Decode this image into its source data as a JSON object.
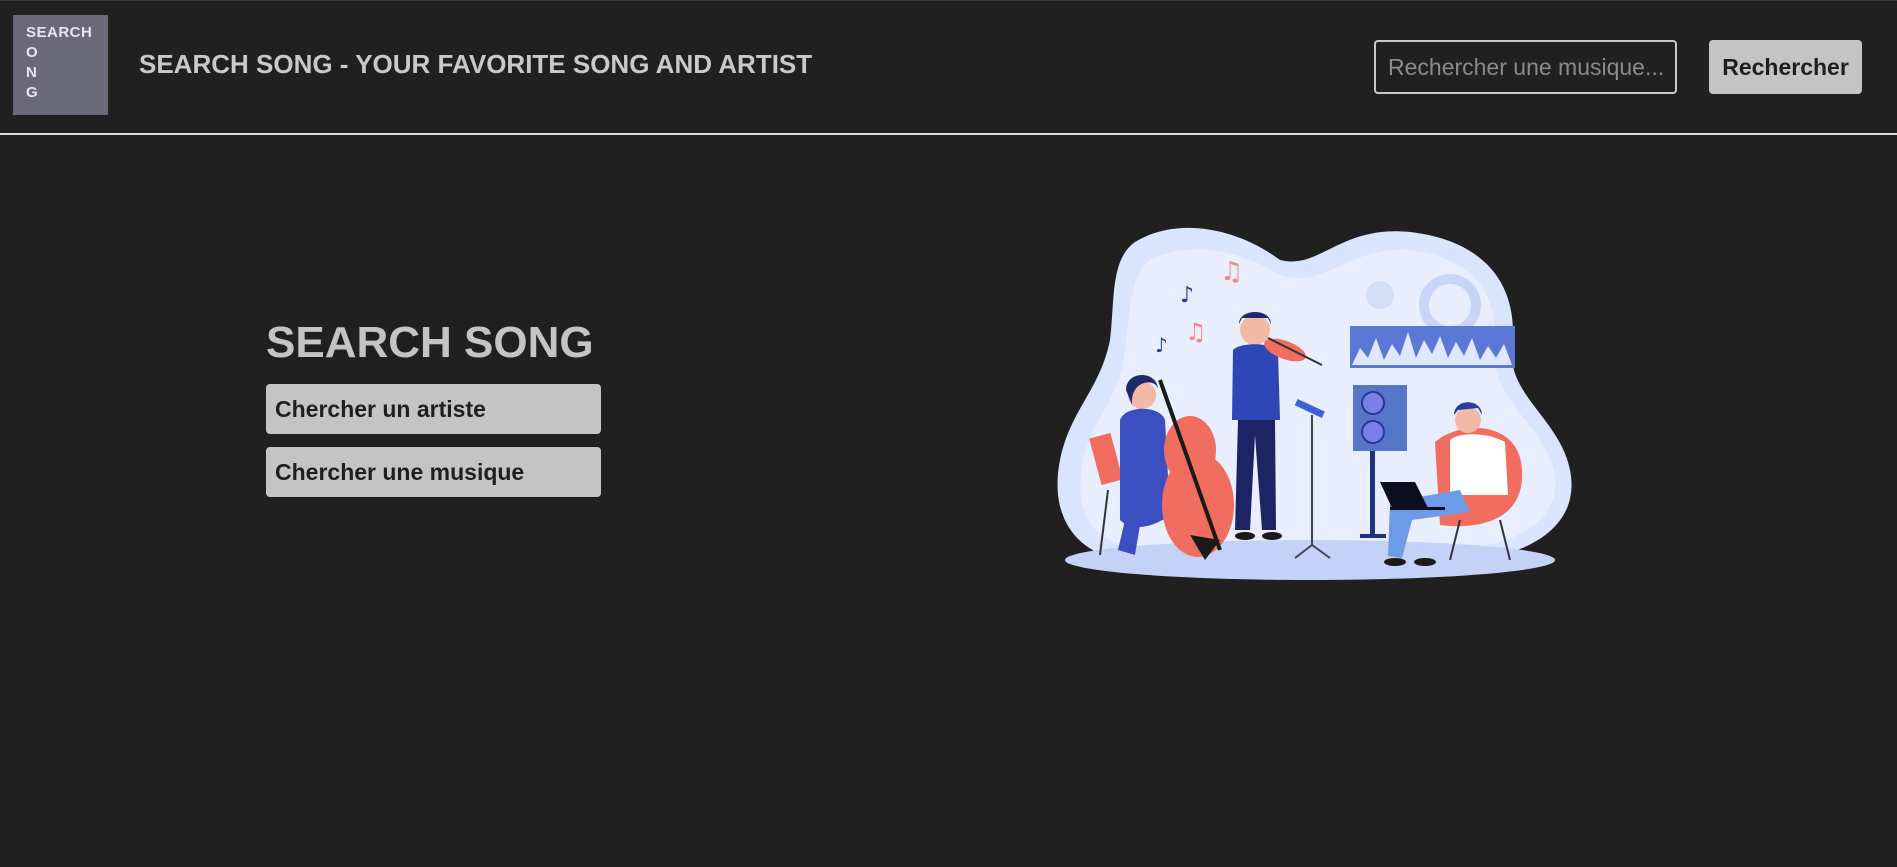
{
  "header": {
    "logo_lines": [
      "SEARCH",
      "O",
      "N",
      "G"
    ],
    "title": "SEARCH SONG - YOUR FAVORITE SONG AND ARTIST",
    "search": {
      "placeholder": "Rechercher une musique...",
      "value": "",
      "button_label": "Rechercher"
    }
  },
  "main": {
    "heading": "SEARCH SONG",
    "buttons": {
      "artist": "Chercher un artiste",
      "music": "Chercher une musique"
    },
    "illustration": "musicians-illustration"
  },
  "colors": {
    "background": "#202020",
    "text": "#c9c9c9",
    "button_bg": "#c4c4c4",
    "logo_bg": "#6b6a7a"
  }
}
